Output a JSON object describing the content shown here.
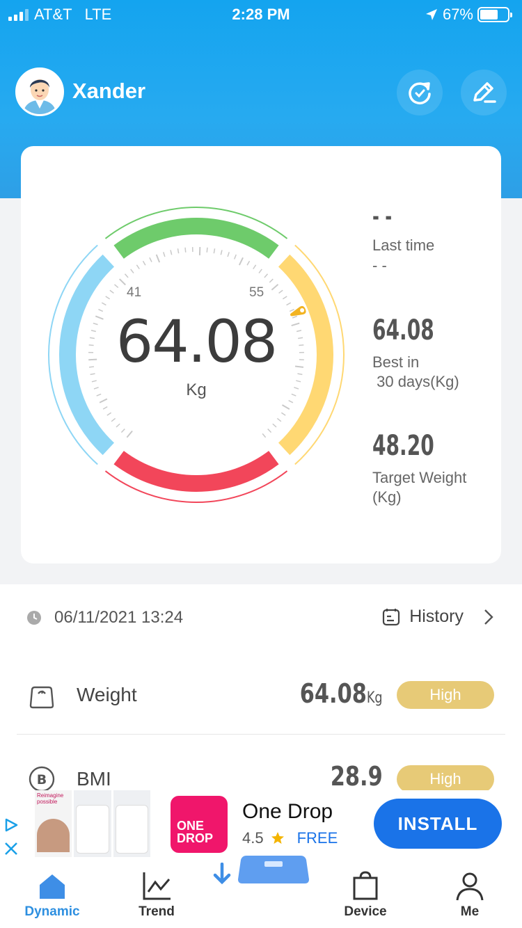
{
  "status_bar": {
    "carrier": "AT&T",
    "network": "LTE",
    "time": "2:28 PM",
    "battery": "67%"
  },
  "header": {
    "username": "Xander"
  },
  "gauge": {
    "value": "64.08",
    "unit": "Kg",
    "left_tick": "41",
    "right_tick": "55",
    "needle_fraction": 0.74
  },
  "side_stats": {
    "last_time_value": "- -",
    "last_time_label": "Last time",
    "last_time_sub": "- -",
    "best_value": "64.08",
    "best_label": "Best in\n 30 days(Kg)",
    "target_value": "48.20",
    "target_label": "Target Weight\n(Kg)"
  },
  "measurement": {
    "datetime": "06/11/2021 13:24",
    "history_label": "History"
  },
  "metrics": [
    {
      "name": "Weight",
      "value": "64.08",
      "unit": "Kg",
      "status": "High",
      "icon": "scale-icon"
    },
    {
      "name": "BMI",
      "value": "28.9",
      "unit": "",
      "status": "High",
      "icon": "bmi-icon"
    }
  ],
  "ad": {
    "title": "One Drop",
    "rating": "4.5",
    "price": "FREE",
    "install_label": "INSTALL",
    "logo_text_1": "ONE",
    "logo_text_2": "DROP",
    "shot_caption": "Reimagine possible"
  },
  "tabs": [
    {
      "label": "Dynamic",
      "icon": "home-icon",
      "active": true
    },
    {
      "label": "Trend",
      "icon": "trend-icon",
      "active": false
    },
    {
      "label": "",
      "icon": "scale-tab-icon",
      "active": false
    },
    {
      "label": "Device",
      "icon": "device-icon",
      "active": false
    },
    {
      "label": "Me",
      "icon": "person-icon",
      "active": false
    }
  ],
  "colors": {
    "header": "#1ea6f0",
    "green": "#6ecb6b",
    "yellow": "#ffd873",
    "red": "#f2465a",
    "blue": "#8ed6f5",
    "badge": "#e7ca77",
    "accent": "#2d8fe0"
  }
}
